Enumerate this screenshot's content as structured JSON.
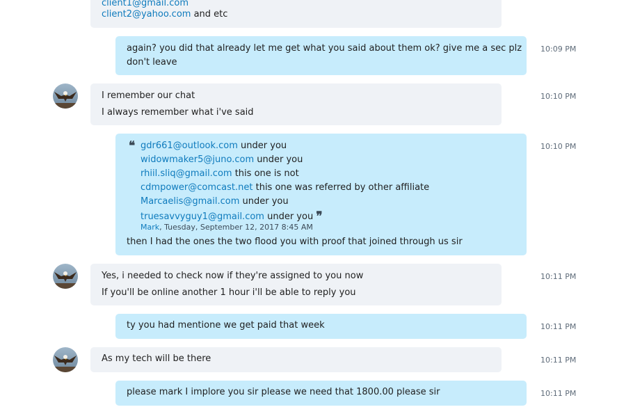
{
  "messages": [
    {
      "id": "m0",
      "direction": "incoming",
      "lines": [
        {
          "link": "client1@gmail.com",
          "text": ""
        },
        {
          "link": "client2@yahoo.com",
          "text": " and etc"
        }
      ]
    },
    {
      "id": "m1",
      "direction": "outgoing",
      "time": "10:09 PM",
      "lines": [
        {
          "text": "again? you did that already let me get what you said about them ok? give me a sec plz"
        },
        {
          "text": "don't leave"
        }
      ]
    },
    {
      "id": "m2",
      "direction": "incoming",
      "time": "10:10 PM",
      "lines": [
        {
          "text": "I remember our chat"
        },
        {
          "text": "I always remember what i've said"
        }
      ]
    },
    {
      "id": "m3",
      "direction": "outgoing",
      "time": "10:10 PM",
      "quote": {
        "open_mark": "❝",
        "close_mark": "❞",
        "lines": [
          {
            "link": "gdr661@outlook.com",
            "text": " under you"
          },
          {
            "link": "widowmaker5@juno.com",
            "text": " under you"
          },
          {
            "link": "rhiil.sliq@gmail.com",
            "text": " this one is not"
          },
          {
            "link": "cdmpower@comcast.net",
            "text": " this one was referred by other affiliate"
          },
          {
            "link": "Marcaelis@gmail.com",
            "text": " under you"
          },
          {
            "link": "truesavvyguy1@gmail.com",
            "text": " under you"
          }
        ],
        "author": "Mark",
        "date": ", Tuesday, September 12, 2017 8:45 AM"
      },
      "lines": [
        {
          "text": "then I had the ones the two flood you with proof that joined through us sir"
        }
      ]
    },
    {
      "id": "m4",
      "direction": "incoming",
      "time": "10:11 PM",
      "lines": [
        {
          "text": "Yes, i needed to check now if they're assigned to you now"
        },
        {
          "text": "If you'll be online another 1 hour i'll be able to reply you"
        }
      ]
    },
    {
      "id": "m5",
      "direction": "outgoing",
      "time": "10:11 PM",
      "lines": [
        {
          "text": "ty you had mentione we get paid that week"
        }
      ]
    },
    {
      "id": "m6",
      "direction": "incoming",
      "time": "10:11 PM",
      "lines": [
        {
          "text": "As my tech will be there"
        }
      ]
    },
    {
      "id": "m7",
      "direction": "outgoing",
      "time": "10:11 PM",
      "lines": [
        {
          "text": "please mark I implore you sir please we need that 1800.00 please sir"
        }
      ]
    }
  ],
  "avatar_icon": "eagle-avatar-icon",
  "colors": {
    "incoming_bubble": "#eff2f6",
    "outgoing_bubble": "#c7ecfc",
    "link": "#0f7bbd",
    "timestamp": "#5e6b79"
  }
}
